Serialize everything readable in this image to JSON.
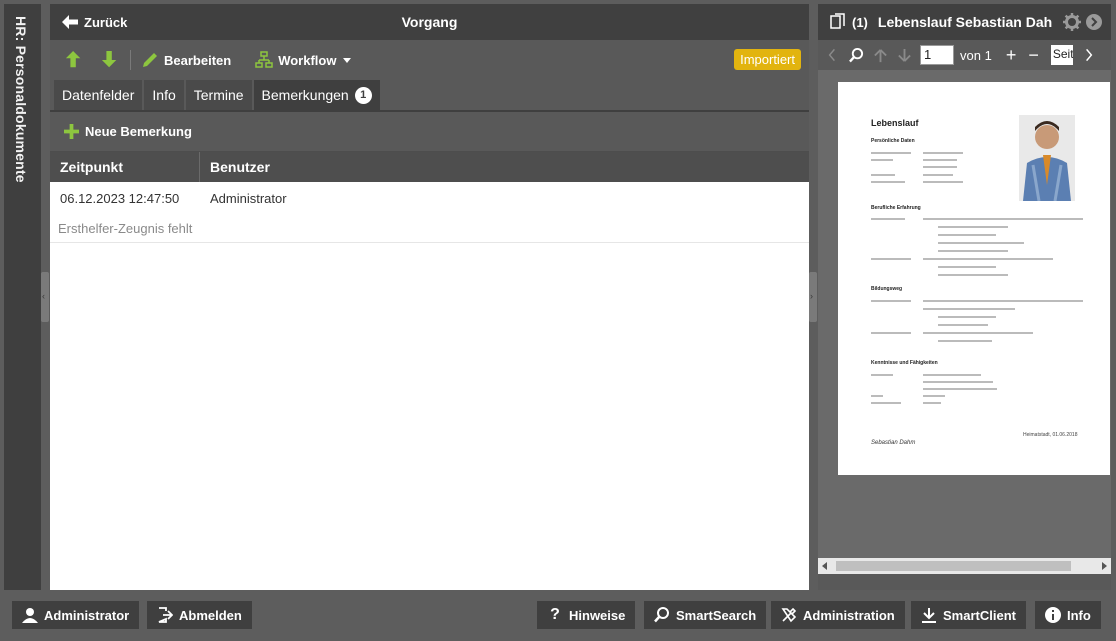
{
  "sidebar": {
    "label": "HR: Personaldokumente"
  },
  "center": {
    "back_label": "Zurück",
    "title": "Vorgang",
    "toolbar": {
      "edit_label": "Bearbeiten",
      "workflow_label": "Workflow",
      "status_badge": "Importiert"
    },
    "tabs": [
      {
        "label": "Datenfelder"
      },
      {
        "label": "Info"
      },
      {
        "label": "Termine"
      },
      {
        "label": "Bemerkungen",
        "count": "1"
      }
    ],
    "new_remark_label": "Neue Bemerkung",
    "grid": {
      "columns": [
        "Zeitpunkt",
        "Benutzer"
      ],
      "rows": [
        {
          "timestamp": "06.12.2023 12:47:50",
          "user": "Administrator",
          "remark": "Ersthelfer-Zeugnis fehlt"
        }
      ]
    }
  },
  "viewer": {
    "doc_count": "(1)",
    "doc_title": "Lebenslauf Sebastian Dahm",
    "page_input": "1",
    "of_label": "von 1",
    "zoom_input": "Seitenbreite",
    "cv": {
      "title": "Lebenslauf",
      "sections": [
        "Persönliche Daten",
        "Berufliche Erfahrung",
        "Bildungsweg",
        "Kenntnisse und Fähigkeiten"
      ],
      "signature": "Sebastian Dahm",
      "place_date": "Heimatstadt, 01.06.2018"
    }
  },
  "bottom": {
    "user_label": "Administrator",
    "logout_label": "Abmelden",
    "hints_label": "Hinweise",
    "smartsearch_label": "SmartSearch",
    "admin_label": "Administration",
    "smartclient_label": "SmartClient",
    "info_label": "Info"
  },
  "colors": {
    "accent_green": "#8dc63f",
    "badge_yellow": "#e2b40f",
    "panel_dark": "#3f3f3f"
  }
}
